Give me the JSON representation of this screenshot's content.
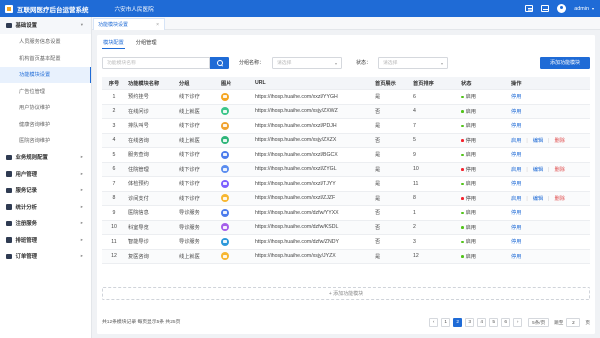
{
  "header": {
    "app_title": "互联网医疗后台运营系统",
    "hospital": "六安市人民医院",
    "user": "admin"
  },
  "sidebar": {
    "groups": [
      {
        "label": "基础设置",
        "icon": "settings-icon",
        "open": true,
        "items": [
          {
            "label": "人员服务信息设置",
            "active": false
          },
          {
            "label": "机构首页基本配置",
            "active": false
          },
          {
            "label": "功能模块设置",
            "active": true
          },
          {
            "label": "广告位管理",
            "active": false
          },
          {
            "label": "用户协议维护",
            "active": false
          },
          {
            "label": "健康咨询维护",
            "active": false
          },
          {
            "label": "医院咨询维护",
            "active": false
          }
        ]
      },
      {
        "label": "业务规则配置",
        "icon": "rules-icon"
      },
      {
        "label": "用户管理",
        "icon": "user-icon"
      },
      {
        "label": "服务记录",
        "icon": "heart-icon"
      },
      {
        "label": "统计分析",
        "icon": "chart-icon"
      },
      {
        "label": "注册服务",
        "icon": "register-icon"
      },
      {
        "label": "排班管理",
        "icon": "calendar-icon"
      },
      {
        "label": "订单管理",
        "icon": "order-icon"
      }
    ]
  },
  "tabbar": {
    "active_tab": "功能模块设置",
    "close": "×"
  },
  "subtabs": [
    "模块配置",
    "分组管理"
  ],
  "filter": {
    "search_placeholder": "功能模块名称",
    "group_label": "分组名称：",
    "group_placeholder": "请选择",
    "status_label": "状态：",
    "status_placeholder": "请选择",
    "add_button": "添加功能模块"
  },
  "table": {
    "columns": [
      "序号",
      "功能模块名称",
      "分组",
      "图片",
      "URL",
      "首页展示",
      "首页排序",
      "状态",
      "操作"
    ],
    "rows": [
      {
        "no": "1",
        "name": "预约挂号",
        "group": "线下诊疗",
        "color": "#f5a623",
        "url": "https://ihosp.huaihe.com/xxzl/YYGH",
        "show": "是",
        "order": "6",
        "status": "启用",
        "on": true
      },
      {
        "no": "2",
        "name": "在线问诊",
        "group": "线上就医",
        "color": "#3cc68a",
        "url": "https://ihosp.huaihe.com/xsjy/ZXWZ",
        "show": "否",
        "order": "4",
        "status": "启用",
        "on": true
      },
      {
        "no": "3",
        "name": "排队叫号",
        "group": "线下诊疗",
        "color": "#f0a22e",
        "url": "https://ihosp.huaihe.com/xxzl/PDJH",
        "show": "是",
        "order": "7",
        "status": "启用",
        "on": true
      },
      {
        "no": "4",
        "name": "在线咨询",
        "group": "线上就医",
        "color": "#2fb67a",
        "url": "https://ihosp.huaihe.com/xsjy/ZXZX",
        "show": "否",
        "order": "5",
        "status": "停用",
        "on": false
      },
      {
        "no": "5",
        "name": "服务查询",
        "group": "线下诊疗",
        "color": "#4b7bec",
        "url": "https://ihosp.huaihe.com/xxzl/BGCX",
        "show": "是",
        "order": "9",
        "status": "启用",
        "on": true
      },
      {
        "no": "6",
        "name": "住院管理",
        "group": "线下诊疗",
        "color": "#5b8def",
        "url": "https://ihosp.huaihe.com/xxzl/ZYGL",
        "show": "是",
        "order": "10",
        "status": "停用",
        "on": false
      },
      {
        "no": "7",
        "name": "体检预约",
        "group": "线下诊疗",
        "color": "#7d5fff",
        "url": "https://ihosp.huaihe.com/xxzl/TJYY",
        "show": "是",
        "order": "11",
        "status": "启用",
        "on": true
      },
      {
        "no": "8",
        "name": "诊间支付",
        "group": "线下诊疗",
        "color": "#f7b731",
        "url": "https://ihosp.huaihe.com/xxzl/ZJZF",
        "show": "是",
        "order": "8",
        "status": "停用",
        "on": false
      },
      {
        "no": "9",
        "name": "医院信息",
        "group": "导诊服务",
        "color": "#4b7bec",
        "url": "https://ihosp.huaihe.com/dzfw/YYXX",
        "show": "否",
        "order": "1",
        "status": "启用",
        "on": true
      },
      {
        "no": "10",
        "name": "科室导览",
        "group": "导诊服务",
        "color": "#a55eea",
        "url": "https://ihosp.huaihe.com/dzfw/KSDL",
        "show": "否",
        "order": "2",
        "status": "启用",
        "on": true
      },
      {
        "no": "11",
        "name": "智能导诊",
        "group": "导诊服务",
        "color": "#2d98da",
        "url": "https://ihosp.huaihe.com/dzfw/ZNDY",
        "show": "否",
        "order": "3",
        "status": "启用",
        "on": true
      },
      {
        "no": "12",
        "name": "复医咨询",
        "group": "线上就医",
        "color": "#f7b731",
        "url": "https://ihosp.huaihe.com/xsjy/JYZX",
        "show": "是",
        "order": "12",
        "status": "启用",
        "on": true
      }
    ],
    "actions": {
      "enable": "启用",
      "edit": "编辑",
      "delete": "删除",
      "disable": "停用"
    },
    "on_color": "#52c41a",
    "off_color": "#f5222d"
  },
  "add_row": "+ 添加功能模块",
  "footer": {
    "total": "共12条模块记录  每页显示5条  共25页",
    "pages": [
      "‹",
      "1",
      "2",
      "3",
      "4",
      "5",
      "6",
      "›"
    ],
    "current_page": "2",
    "page_size": "5条/页",
    "jump_label": "跳至",
    "jump_value": "2",
    "jump_unit": "页"
  }
}
